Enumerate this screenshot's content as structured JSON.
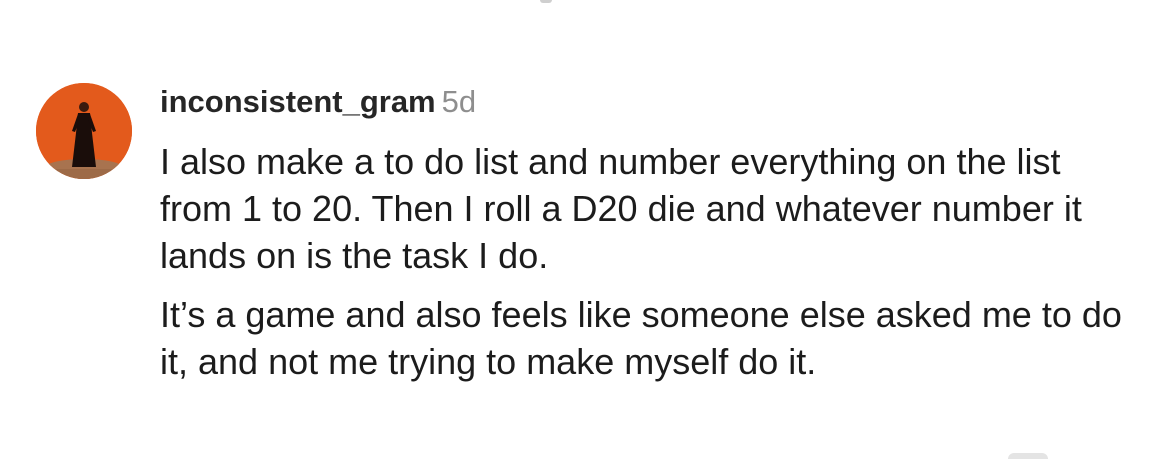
{
  "comment": {
    "username": "inconsistent_gram",
    "timestamp": "5d",
    "avatar_icon": "user-avatar-photo",
    "paragraphs": [
      "I also make a to do list and number everything on the list from 1 to 20. Then I roll a D20 die and whatever number it lands on is the task I do.",
      "It’s a game and also feels like someone else asked me to do it, and not me trying to make myself do it."
    ]
  },
  "colors": {
    "username": "#262626",
    "timestamp": "#8e8e8e",
    "text": "#1c1c1c",
    "avatar_background": "#e85a1f"
  }
}
